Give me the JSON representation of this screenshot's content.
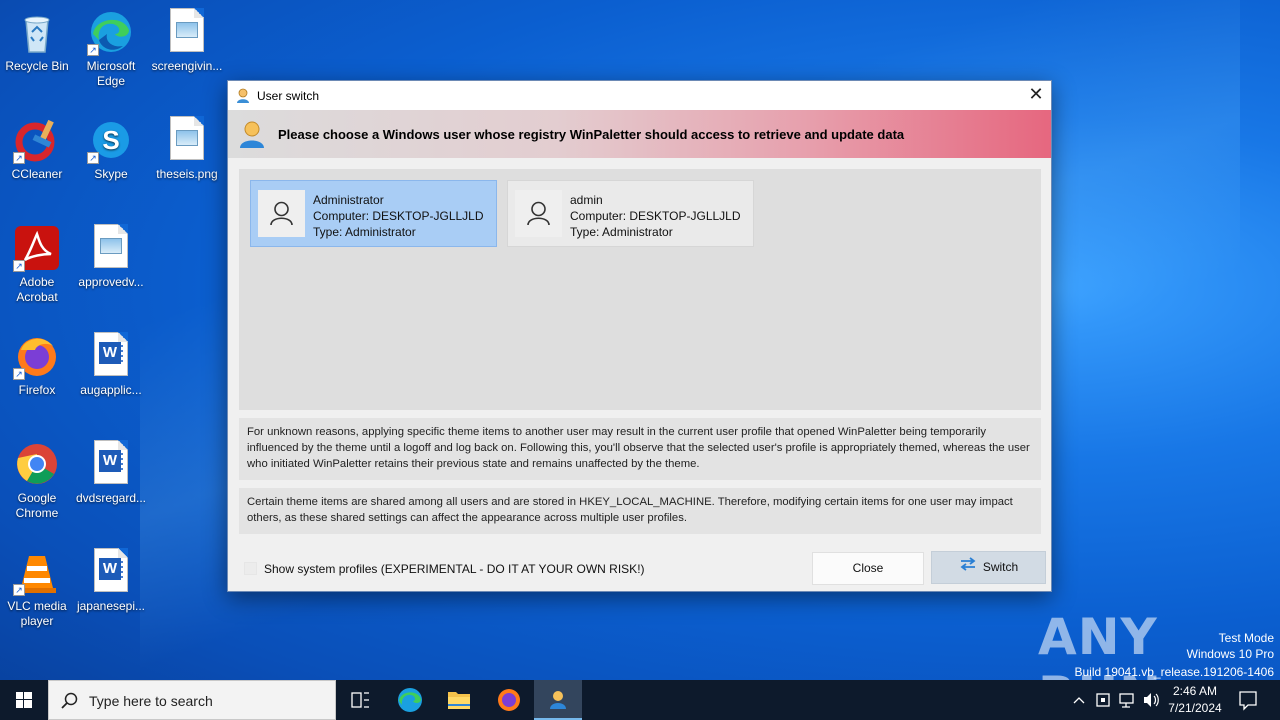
{
  "desktop": {
    "icons": [
      {
        "label": "Recycle Bin"
      },
      {
        "label": "Microsoft Edge"
      },
      {
        "label": "screengivin..."
      },
      {
        "label": "CCleaner"
      },
      {
        "label": "Skype"
      },
      {
        "label": "theseis.png"
      },
      {
        "label": "Adobe Acrobat"
      },
      {
        "label": "approvedv..."
      },
      {
        "label": "Firefox"
      },
      {
        "label": "augapplic..."
      },
      {
        "label": "Google Chrome"
      },
      {
        "label": "dvdsregard..."
      },
      {
        "label": "VLC media player"
      },
      {
        "label": "japanesepi..."
      }
    ]
  },
  "dialog": {
    "title": "User switch",
    "close_glyph": "✕",
    "banner_text": "Please choose a Windows user whose registry WinPaletter should access to retrieve and update data",
    "users": [
      {
        "name": "Administrator",
        "computer": "Computer:  DESKTOP-JGLLJLD",
        "type": "Type: Administrator",
        "selected": true
      },
      {
        "name": "admin",
        "computer": "Computer:  DESKTOP-JGLLJLD",
        "type": "Type: Administrator",
        "selected": false
      }
    ],
    "note1": "For unknown reasons, applying specific theme items to another user may result in the current user profile that opened WinPaletter being temporarily influenced by the theme until a logoff and log back on. Following this, you'll observe that the selected user's profile is appropriately themed, whereas the user who initiated WinPaletter retains their previous state and remains unaffected by the theme.",
    "note2": "Certain theme items are shared among all users and are stored in HKEY_LOCAL_MACHINE. Therefore, modifying certain items for one user may impact others, as these shared settings can affect the appearance across multiple user profiles.",
    "show_system_label": "Show system profiles (EXPERIMENTAL - DO IT AT YOUR OWN RISK!)",
    "show_system_checked": false,
    "close_button": "Close",
    "switch_button": "Switch"
  },
  "watermark": {
    "brand": "ANY RUN",
    "line1": "Test Mode",
    "line2": "Windows 10 Pro",
    "line3": "Build 19041.vb_release.191206-1406"
  },
  "taskbar": {
    "search_placeholder": "Type here to search",
    "time": "2:46 AM",
    "date": "7/21/2024"
  }
}
